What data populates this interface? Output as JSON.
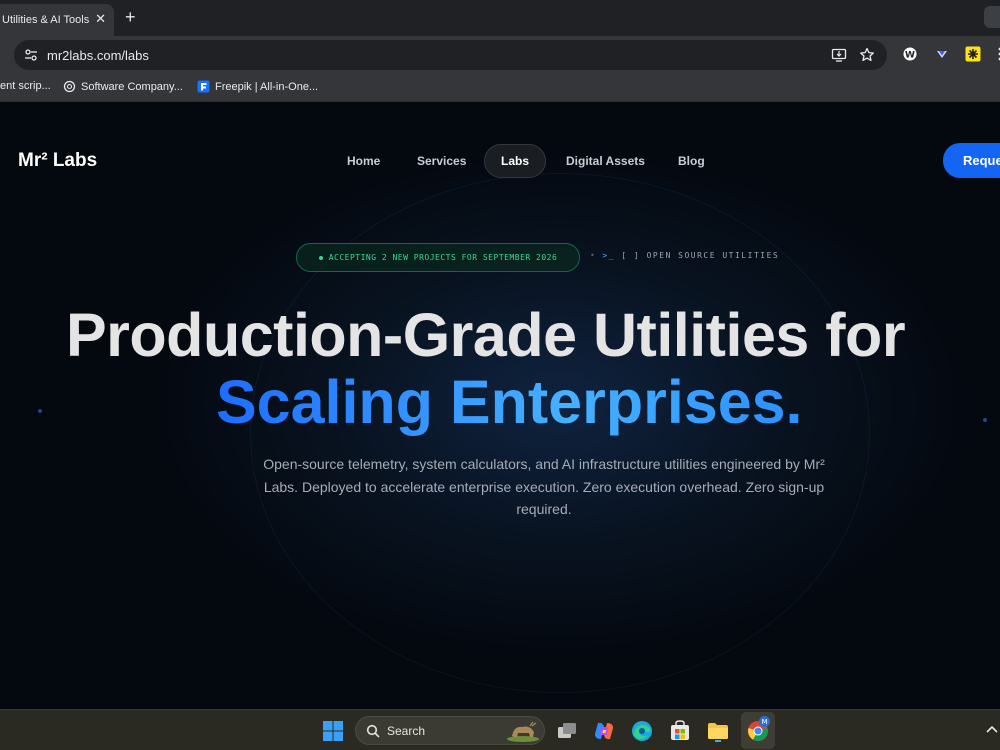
{
  "browser": {
    "tab_title": "Utilities & AI Tools",
    "tab_close": "✕",
    "new_tab": "+",
    "url": "mr2labs.com/labs",
    "bookmarks": [
      {
        "label": "ent scrip..."
      },
      {
        "label": "Software Company..."
      },
      {
        "label": "Freepik | All-in-One..."
      }
    ]
  },
  "site": {
    "logo": "Mr² Labs",
    "nav": [
      {
        "label": "Home"
      },
      {
        "label": "Services"
      },
      {
        "label": "Labs",
        "active": true
      },
      {
        "label": "Digital Assets"
      },
      {
        "label": "Blog"
      }
    ],
    "cta_label": "Request",
    "badge": "ACCEPTING 2 NEW PROJECTS FOR SEPTEMBER 2026",
    "oss_prompt": ">_",
    "oss_label": "[ ] OPEN SOURCE UTILITIES",
    "headline_line1": "Production-Grade Utilities for",
    "headline_line2": "Scaling Enterprises.",
    "subtitle": "Open-source telemetry, system calculators, and AI infrastructure utilities engineered by Mr² Labs. Deployed to accelerate enterprise execution. Zero execution overhead. Zero sign-up required."
  },
  "taskbar": {
    "search_label": "Search",
    "apps": [
      "windows-start-icon",
      "task-view-icon",
      "copilot-icon",
      "edge-icon",
      "store-icon",
      "file-explorer-icon",
      "chrome-icon"
    ]
  },
  "colors": {
    "accent_blue": "#1565f5",
    "headline_blue": "#2b87ff",
    "badge_green": "#3ad68f"
  }
}
